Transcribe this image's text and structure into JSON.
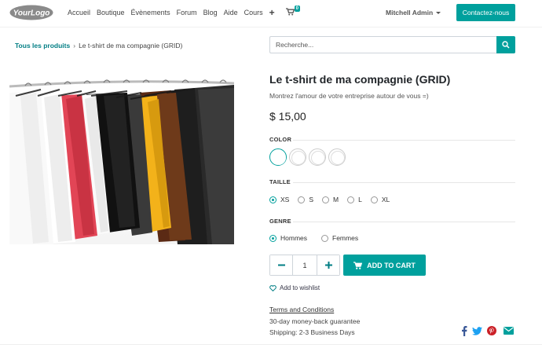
{
  "header": {
    "logo_text": "YourLogo",
    "nav": [
      "Accueil",
      "Boutique",
      "Évènements",
      "Forum",
      "Blog",
      "Aide",
      "Cours"
    ],
    "add_icon": "plus-icon",
    "cart_icon": "shopping-cart-icon",
    "cart_count": "0",
    "user_name": "Mitchell Admin",
    "contact_label": "Contactez-nous"
  },
  "breadcrumb": {
    "parent": "Tous les produits",
    "separator": "›",
    "current": "Le t-shirt de ma compagnie (GRID)"
  },
  "search": {
    "placeholder": "Recherche...",
    "icon": "search-icon"
  },
  "product": {
    "title": "Le t-shirt de ma compagnie (GRID)",
    "subtitle": "Montrez l'amour de votre entreprise autour de vous =)",
    "price": "$ 15,00",
    "image_subject": "t-shirts on hangers"
  },
  "color": {
    "label": "COLOR",
    "swatch_count": 4,
    "selected_index": 0
  },
  "size": {
    "label": "TAILLE",
    "options": [
      "XS",
      "S",
      "M",
      "L",
      "XL"
    ],
    "selected": "XS"
  },
  "gender": {
    "label": "GENRE",
    "options": [
      "Hommes",
      "Femmes"
    ],
    "selected": "Hommes"
  },
  "cart": {
    "quantity": "1",
    "minus_icon": "minus-icon",
    "plus_icon": "plus-icon",
    "add_label": "ADD TO CART",
    "wishlist_label": "Add to wishlist",
    "wishlist_icon": "heart-icon"
  },
  "info": {
    "terms": "Terms and Conditions",
    "guarantee": "30-day money-back guarantee",
    "shipping": "Shipping: 2-3 Business Days"
  },
  "social": [
    "facebook-icon",
    "twitter-icon",
    "pinterest-icon",
    "email-icon"
  ],
  "colors": {
    "primary": "#00a09d",
    "link": "#017e84",
    "facebook": "#3b5998",
    "twitter": "#1da1f2",
    "pinterest": "#cb2027",
    "email": "#00a09d"
  }
}
